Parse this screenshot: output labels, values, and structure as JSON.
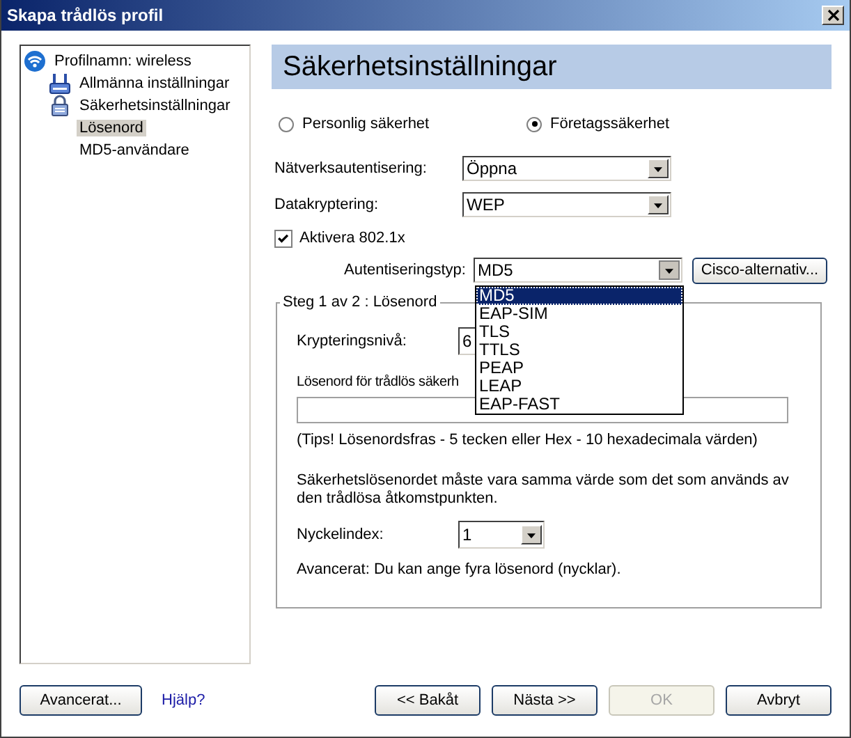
{
  "window": {
    "title": "Skapa trådlös profil"
  },
  "tree": [
    {
      "label": "Profilnamn: wireless",
      "kind": "network",
      "selected": false,
      "children": [
        {
          "label": "Allmänna inställningar",
          "kind": "general",
          "selected": false
        },
        {
          "label": "Säkerhetsinställningar",
          "kind": "security",
          "selected": false,
          "children": [
            {
              "label": "Lösenord",
              "selected": true
            },
            {
              "label": "MD5-användare",
              "selected": false
            }
          ]
        }
      ]
    }
  ],
  "panel": {
    "heading": "Säkerhetsinställningar",
    "security_mode": [
      {
        "label": "Personlig säkerhet",
        "selected": false
      },
      {
        "label": "Företagssäkerhet",
        "selected": true
      }
    ],
    "network_authentication": {
      "label": "Nätverksautentisering:",
      "value": "Öppna"
    },
    "data_encryption": {
      "label": "Datakryptering:",
      "value": "WEP"
    },
    "enable_8021x": {
      "label": "Aktivera 802.1x",
      "checked": true
    },
    "authentication_type": {
      "label": "Autentiseringstyp:",
      "value": "MD5",
      "expanded": true,
      "options": [
        {
          "label": "MD5",
          "selected": true
        },
        {
          "label": "EAP-SIM",
          "selected": false
        },
        {
          "label": "TLS",
          "selected": false
        },
        {
          "label": "TTLS",
          "selected": false
        },
        {
          "label": "PEAP",
          "selected": false
        },
        {
          "label": "LEAP",
          "selected": false
        },
        {
          "label": "EAP-FAST",
          "selected": false
        }
      ]
    },
    "cisco_button": "Cisco-alternativ...",
    "group": {
      "title": "Steg 1 av 2 : Lösenord",
      "encryption_level": {
        "label": "Krypteringsnivå:",
        "value": "6"
      },
      "password": {
        "label": "Lösenord för trådlös säkerh"
      },
      "tip": "(Tips! Lösenordsfras - 5 tecken eller Hex - 10 hexadecimala värden)",
      "note": "Säkerhetslösenordet måste vara samma värde som det som används av den trådlösa åtkomstpunkten.",
      "key_index": {
        "label": "Nyckelindex:",
        "value": "1"
      },
      "advanced_note": "Avancerat: Du kan ange fyra lösenord (nycklar)."
    }
  },
  "footer": {
    "advanced_button": "Avancerat...",
    "help_link": "Hjälp?",
    "buttons": [
      {
        "label": "<< Bakåt",
        "disabled": false
      },
      {
        "label": "Nästa >>",
        "disabled": false
      },
      {
        "label": "OK",
        "disabled": true
      },
      {
        "label": "Avbryt",
        "disabled": false
      }
    ]
  }
}
